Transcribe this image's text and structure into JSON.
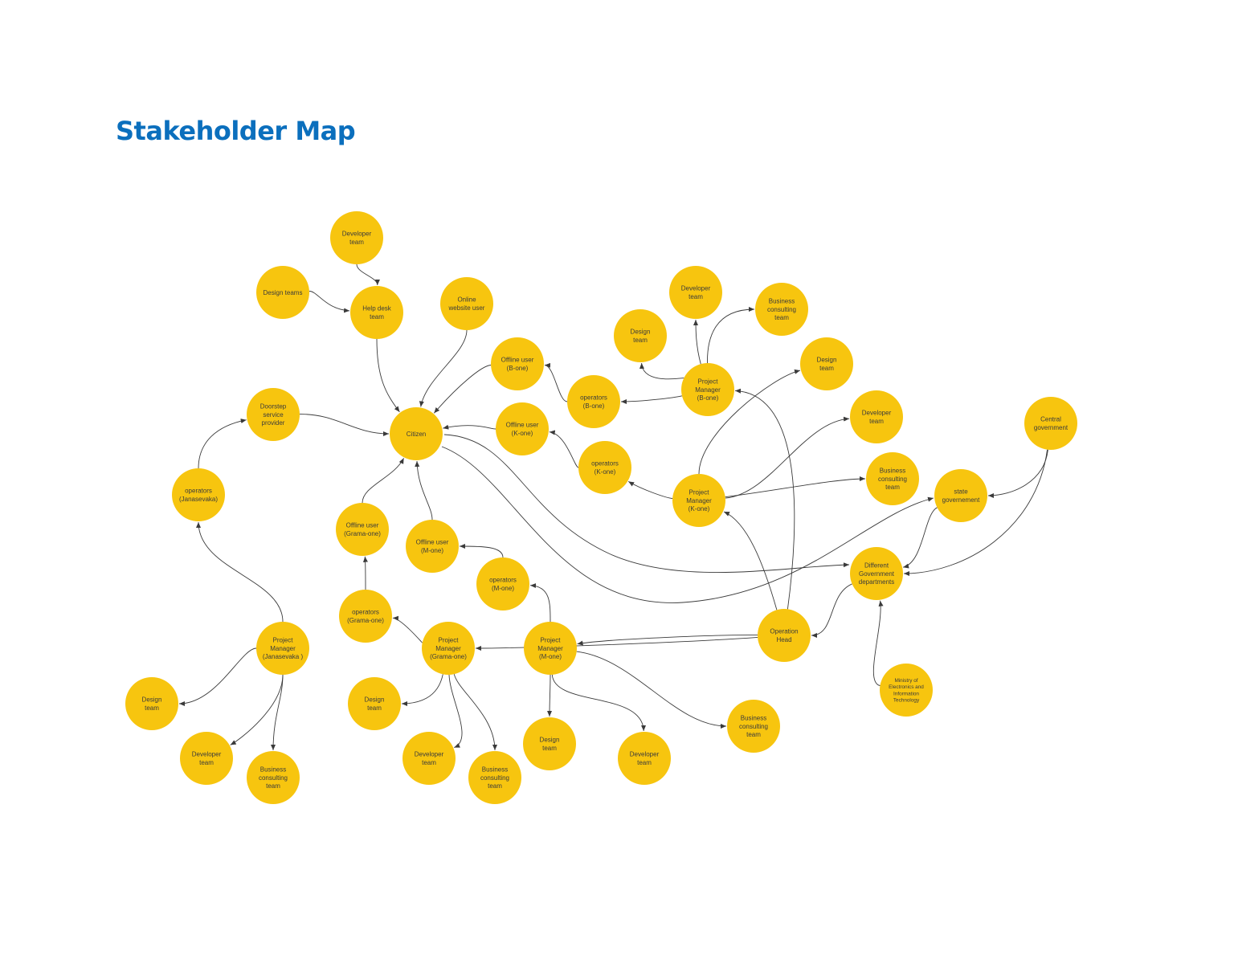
{
  "title": "Stakeholder Map",
  "colors": {
    "title": "#0b6fbd",
    "node": "#f7c50f",
    "edge": "#3a3a3a",
    "text": "#3b3b3b"
  },
  "nodes": [
    {
      "id": "dev_help",
      "lines": [
        "Developer",
        "team"
      ]
    },
    {
      "id": "design_teams",
      "lines": [
        "Design teams"
      ]
    },
    {
      "id": "helpdesk",
      "lines": [
        "Help desk",
        "team"
      ]
    },
    {
      "id": "online_user",
      "lines": [
        "Online",
        "website user"
      ]
    },
    {
      "id": "offline_b",
      "lines": [
        "Offline user",
        "(B-one)"
      ]
    },
    {
      "id": "ops_b",
      "lines": [
        "operators",
        "(B-one)"
      ]
    },
    {
      "id": "pm_b",
      "lines": [
        "Project",
        "Manager",
        "(B-one)"
      ]
    },
    {
      "id": "design_b",
      "lines": [
        "Design",
        "team"
      ]
    },
    {
      "id": "dev_b",
      "lines": [
        "Developer",
        "team"
      ]
    },
    {
      "id": "biz_b",
      "lines": [
        "Business",
        "consulting",
        "team"
      ]
    },
    {
      "id": "design_k",
      "lines": [
        "Design",
        "team"
      ]
    },
    {
      "id": "dev_k",
      "lines": [
        "Developer",
        "team"
      ]
    },
    {
      "id": "biz_k",
      "lines": [
        "Business",
        "consulting",
        "team"
      ]
    },
    {
      "id": "central_gov",
      "lines": [
        "Central",
        "government"
      ]
    },
    {
      "id": "state_gov",
      "lines": [
        "state",
        "governement"
      ]
    },
    {
      "id": "doorstep",
      "lines": [
        "Doorstep",
        "service",
        "provider"
      ]
    },
    {
      "id": "citizen",
      "lines": [
        "Citizen"
      ]
    },
    {
      "id": "offline_k",
      "lines": [
        "Offline user",
        "(K-one)"
      ]
    },
    {
      "id": "ops_k",
      "lines": [
        "operators",
        "(K-one)"
      ]
    },
    {
      "id": "pm_k",
      "lines": [
        "Project",
        "Manager",
        "(K-one)"
      ]
    },
    {
      "id": "ops_jana",
      "lines": [
        "operators",
        "(Janasevaka)"
      ]
    },
    {
      "id": "offline_g",
      "lines": [
        "Offline user",
        "(Grama-one)"
      ]
    },
    {
      "id": "offline_m",
      "lines": [
        "Offline user",
        "(M-one)"
      ]
    },
    {
      "id": "ops_m",
      "lines": [
        "operators",
        "(M-one)"
      ]
    },
    {
      "id": "diff_gov",
      "lines": [
        "Different",
        "Government",
        "departments"
      ]
    },
    {
      "id": "ops_g",
      "lines": [
        "operators",
        "(Grama-one)"
      ]
    },
    {
      "id": "op_head",
      "lines": [
        "Operation",
        "Head"
      ]
    },
    {
      "id": "pm_jana",
      "lines": [
        "Project",
        "Manager",
        "(Janasevaka )"
      ]
    },
    {
      "id": "pm_g",
      "lines": [
        "Project",
        "Manager",
        "(Grama-one)"
      ]
    },
    {
      "id": "pm_m",
      "lines": [
        "Project",
        "Manager",
        "(M-one)"
      ]
    },
    {
      "id": "ministry",
      "lines": [
        "Ministry of",
        "Electronics and",
        "Information",
        "Technology"
      ]
    },
    {
      "id": "design_jana",
      "lines": [
        "Design",
        "team"
      ]
    },
    {
      "id": "dev_jana",
      "lines": [
        "Developer",
        "team"
      ]
    },
    {
      "id": "biz_jana",
      "lines": [
        "Business",
        "consulting",
        "team"
      ]
    },
    {
      "id": "design_g",
      "lines": [
        "Design",
        "team"
      ]
    },
    {
      "id": "dev_g",
      "lines": [
        "Developer",
        "team"
      ]
    },
    {
      "id": "biz_g",
      "lines": [
        "Business",
        "consulting",
        "team"
      ]
    },
    {
      "id": "design_m",
      "lines": [
        "Design",
        "team"
      ]
    },
    {
      "id": "dev_m",
      "lines": [
        "Developer",
        "team"
      ]
    },
    {
      "id": "biz_m",
      "lines": [
        "Business",
        "consulting",
        "team"
      ]
    }
  ],
  "edges": [
    {
      "from": "dev_help",
      "to": "helpdesk"
    },
    {
      "from": "design_teams",
      "to": "helpdesk"
    },
    {
      "from": "helpdesk",
      "to": "citizen"
    },
    {
      "from": "online_user",
      "to": "citizen"
    },
    {
      "from": "offline_b",
      "to": "citizen"
    },
    {
      "from": "offline_k",
      "to": "citizen"
    },
    {
      "from": "doorstep",
      "to": "citizen"
    },
    {
      "from": "offline_g",
      "to": "citizen"
    },
    {
      "from": "offline_m",
      "to": "citizen"
    },
    {
      "from": "ops_b",
      "to": "offline_b"
    },
    {
      "from": "ops_k",
      "to": "offline_k"
    },
    {
      "from": "ops_g",
      "to": "offline_g"
    },
    {
      "from": "ops_m",
      "to": "offline_m"
    },
    {
      "from": "ops_jana",
      "to": "doorstep"
    },
    {
      "from": "pm_jana",
      "to": "ops_jana"
    },
    {
      "from": "pm_b",
      "to": "ops_b"
    },
    {
      "from": "pm_b",
      "to": "design_b"
    },
    {
      "from": "pm_b",
      "to": "dev_b"
    },
    {
      "from": "pm_b",
      "to": "biz_b"
    },
    {
      "from": "pm_k",
      "to": "ops_k"
    },
    {
      "from": "pm_k",
      "to": "design_k"
    },
    {
      "from": "pm_k",
      "to": "dev_k"
    },
    {
      "from": "pm_k",
      "to": "biz_k"
    },
    {
      "from": "pm_g",
      "to": "ops_g"
    },
    {
      "from": "pm_m",
      "to": "ops_m"
    },
    {
      "from": "pm_jana",
      "to": "design_jana"
    },
    {
      "from": "pm_jana",
      "to": "dev_jana"
    },
    {
      "from": "pm_jana",
      "to": "biz_jana"
    },
    {
      "from": "pm_g",
      "to": "design_g"
    },
    {
      "from": "pm_g",
      "to": "dev_g"
    },
    {
      "from": "pm_g",
      "to": "biz_g"
    },
    {
      "from": "pm_m",
      "to": "design_m"
    },
    {
      "from": "pm_m",
      "to": "dev_m"
    },
    {
      "from": "pm_m",
      "to": "biz_m"
    },
    {
      "from": "op_head",
      "to": "pm_b"
    },
    {
      "from": "op_head",
      "to": "pm_k"
    },
    {
      "from": "op_head",
      "to": "pm_m"
    },
    {
      "from": "op_head",
      "to": "pm_g"
    },
    {
      "from": "diff_gov",
      "to": "op_head"
    },
    {
      "from": "citizen",
      "to": "diff_gov"
    },
    {
      "from": "citizen",
      "to": "state_gov"
    },
    {
      "from": "central_gov",
      "to": "state_gov"
    },
    {
      "from": "central_gov",
      "to": "diff_gov"
    },
    {
      "from": "state_gov",
      "to": "diff_gov"
    },
    {
      "from": "ministry",
      "to": "diff_gov"
    }
  ]
}
